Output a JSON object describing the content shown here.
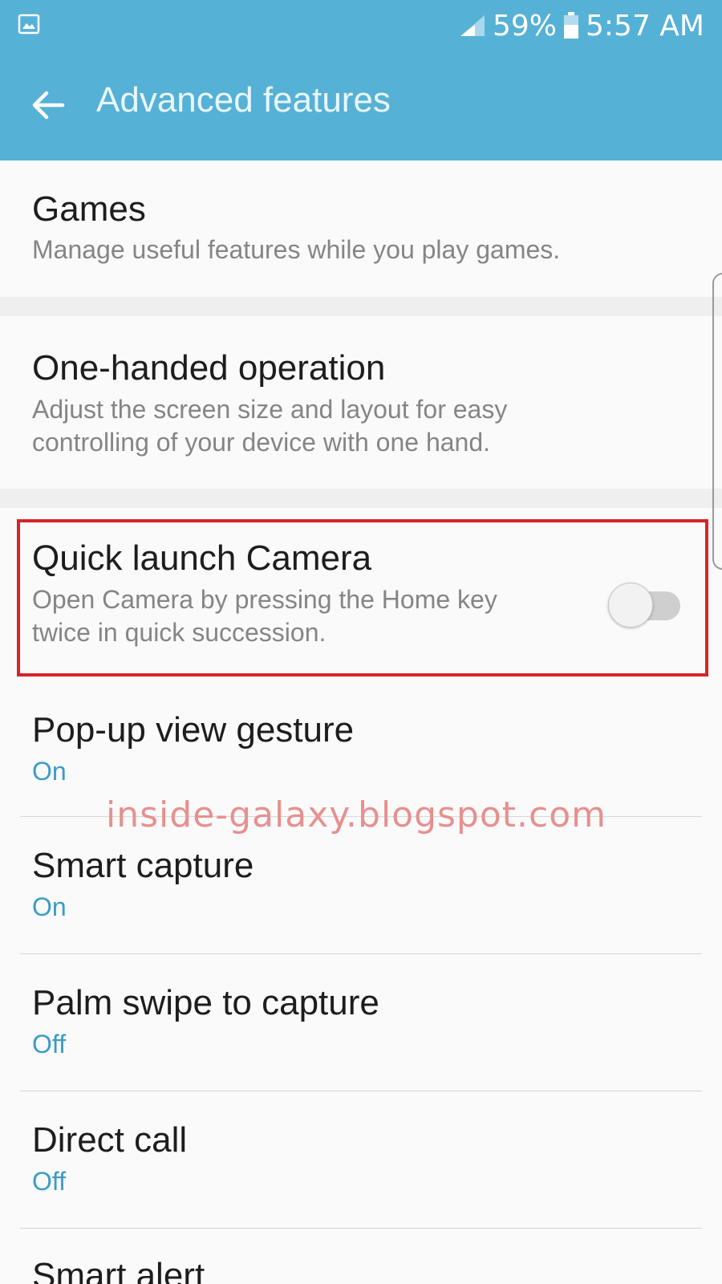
{
  "status_bar": {
    "battery_percent": "59%",
    "time": "5:57 AM",
    "icons": [
      "image-notification-icon",
      "signal-icon",
      "battery-icon"
    ]
  },
  "app_bar": {
    "title": "Advanced features",
    "back_icon": "back-arrow-icon"
  },
  "settings": {
    "games": {
      "title": "Games",
      "summary": "Manage useful features while you play games."
    },
    "one_handed": {
      "title": "One-handed operation",
      "summary_line1": "Adjust the screen size and layout for easy",
      "summary_line2": "controlling of your device with one hand."
    },
    "quick_launch": {
      "title": "Quick launch Camera",
      "summary_line1": "Open Camera by pressing the Home key",
      "summary_line2": "twice in quick succession.",
      "toggle_on": false
    },
    "popup": {
      "title": "Pop-up view gesture",
      "status": "On"
    },
    "smart_capture": {
      "title": "Smart capture",
      "status": "On"
    },
    "palm_swipe": {
      "title": "Palm swipe to capture",
      "status": "Off"
    },
    "direct_call": {
      "title": "Direct call",
      "status": "Off"
    },
    "smart_alert": {
      "title": "Smart alert"
    }
  },
  "watermark": "inside-galaxy.blogspot.com",
  "colors": {
    "app_bar": "#56b1d6",
    "status_value": "#3b9cc4",
    "highlight": "#d8232a"
  }
}
